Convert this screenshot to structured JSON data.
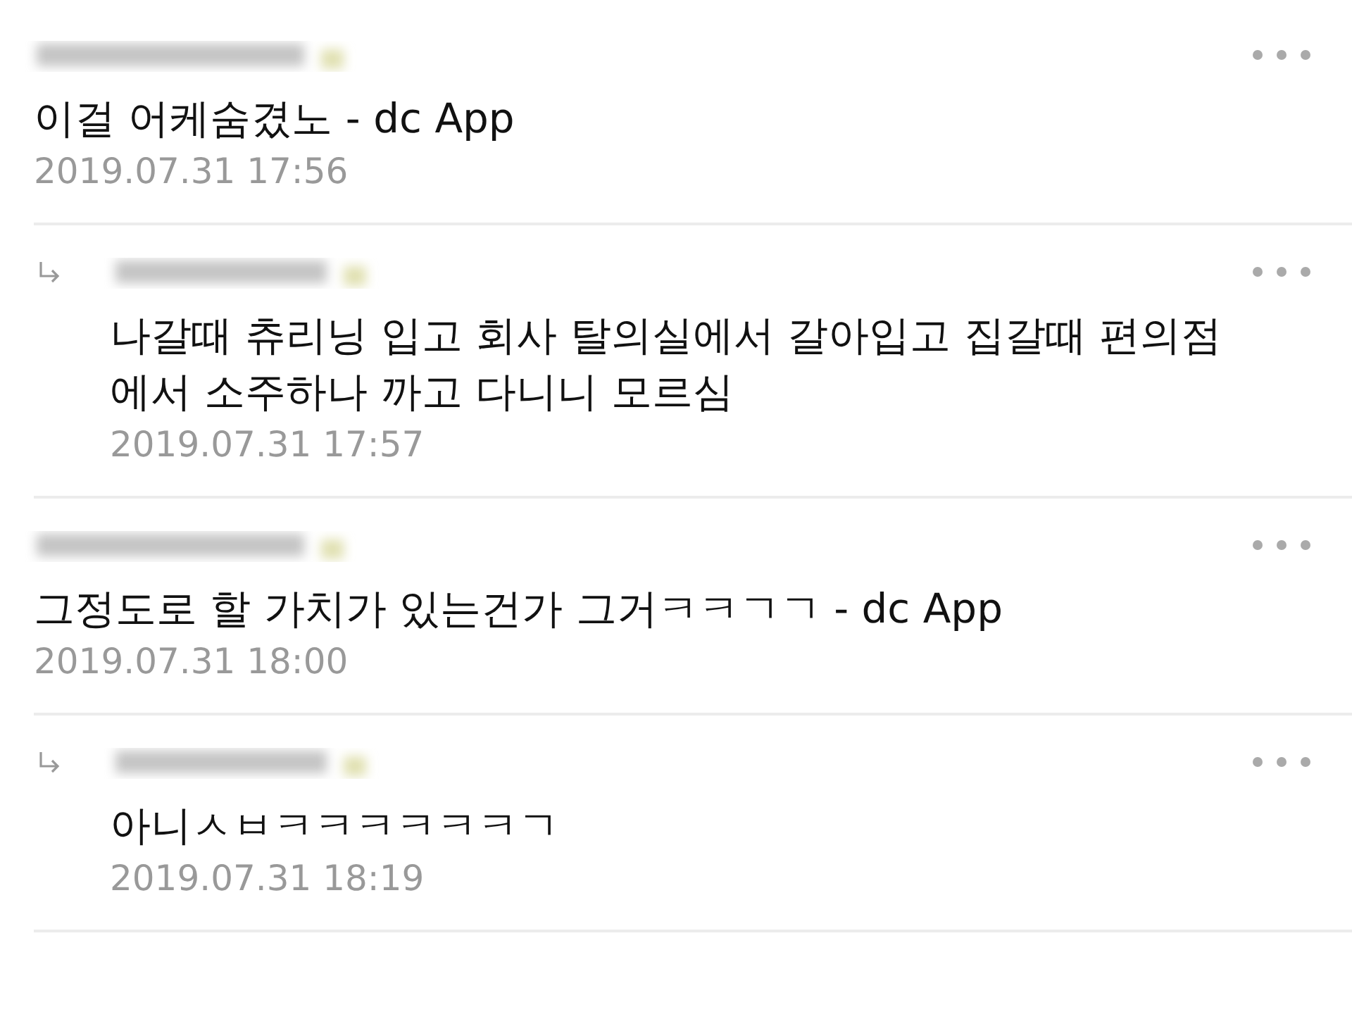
{
  "comments": [
    {
      "kind": "comment",
      "text": "이걸 어케숨겼노 - dc App",
      "date": "2019.07.31 17:56"
    },
    {
      "kind": "reply",
      "text": "나갈때 츄리닝 입고 회사 탈의실에서 갈아입고 집갈때 편의점에서 소주하나 까고 다니니 모르심",
      "date": "2019.07.31 17:57"
    },
    {
      "kind": "comment",
      "text": "그정도로 할 가치가 있는건가 그거ㅋㅋㄱㄱ - dc App",
      "date": "2019.07.31 18:00"
    },
    {
      "kind": "reply",
      "text": "아니ㅅㅂㅋㅋㅋㅋㅋㅋㄱ",
      "date": "2019.07.31 18:19"
    }
  ]
}
